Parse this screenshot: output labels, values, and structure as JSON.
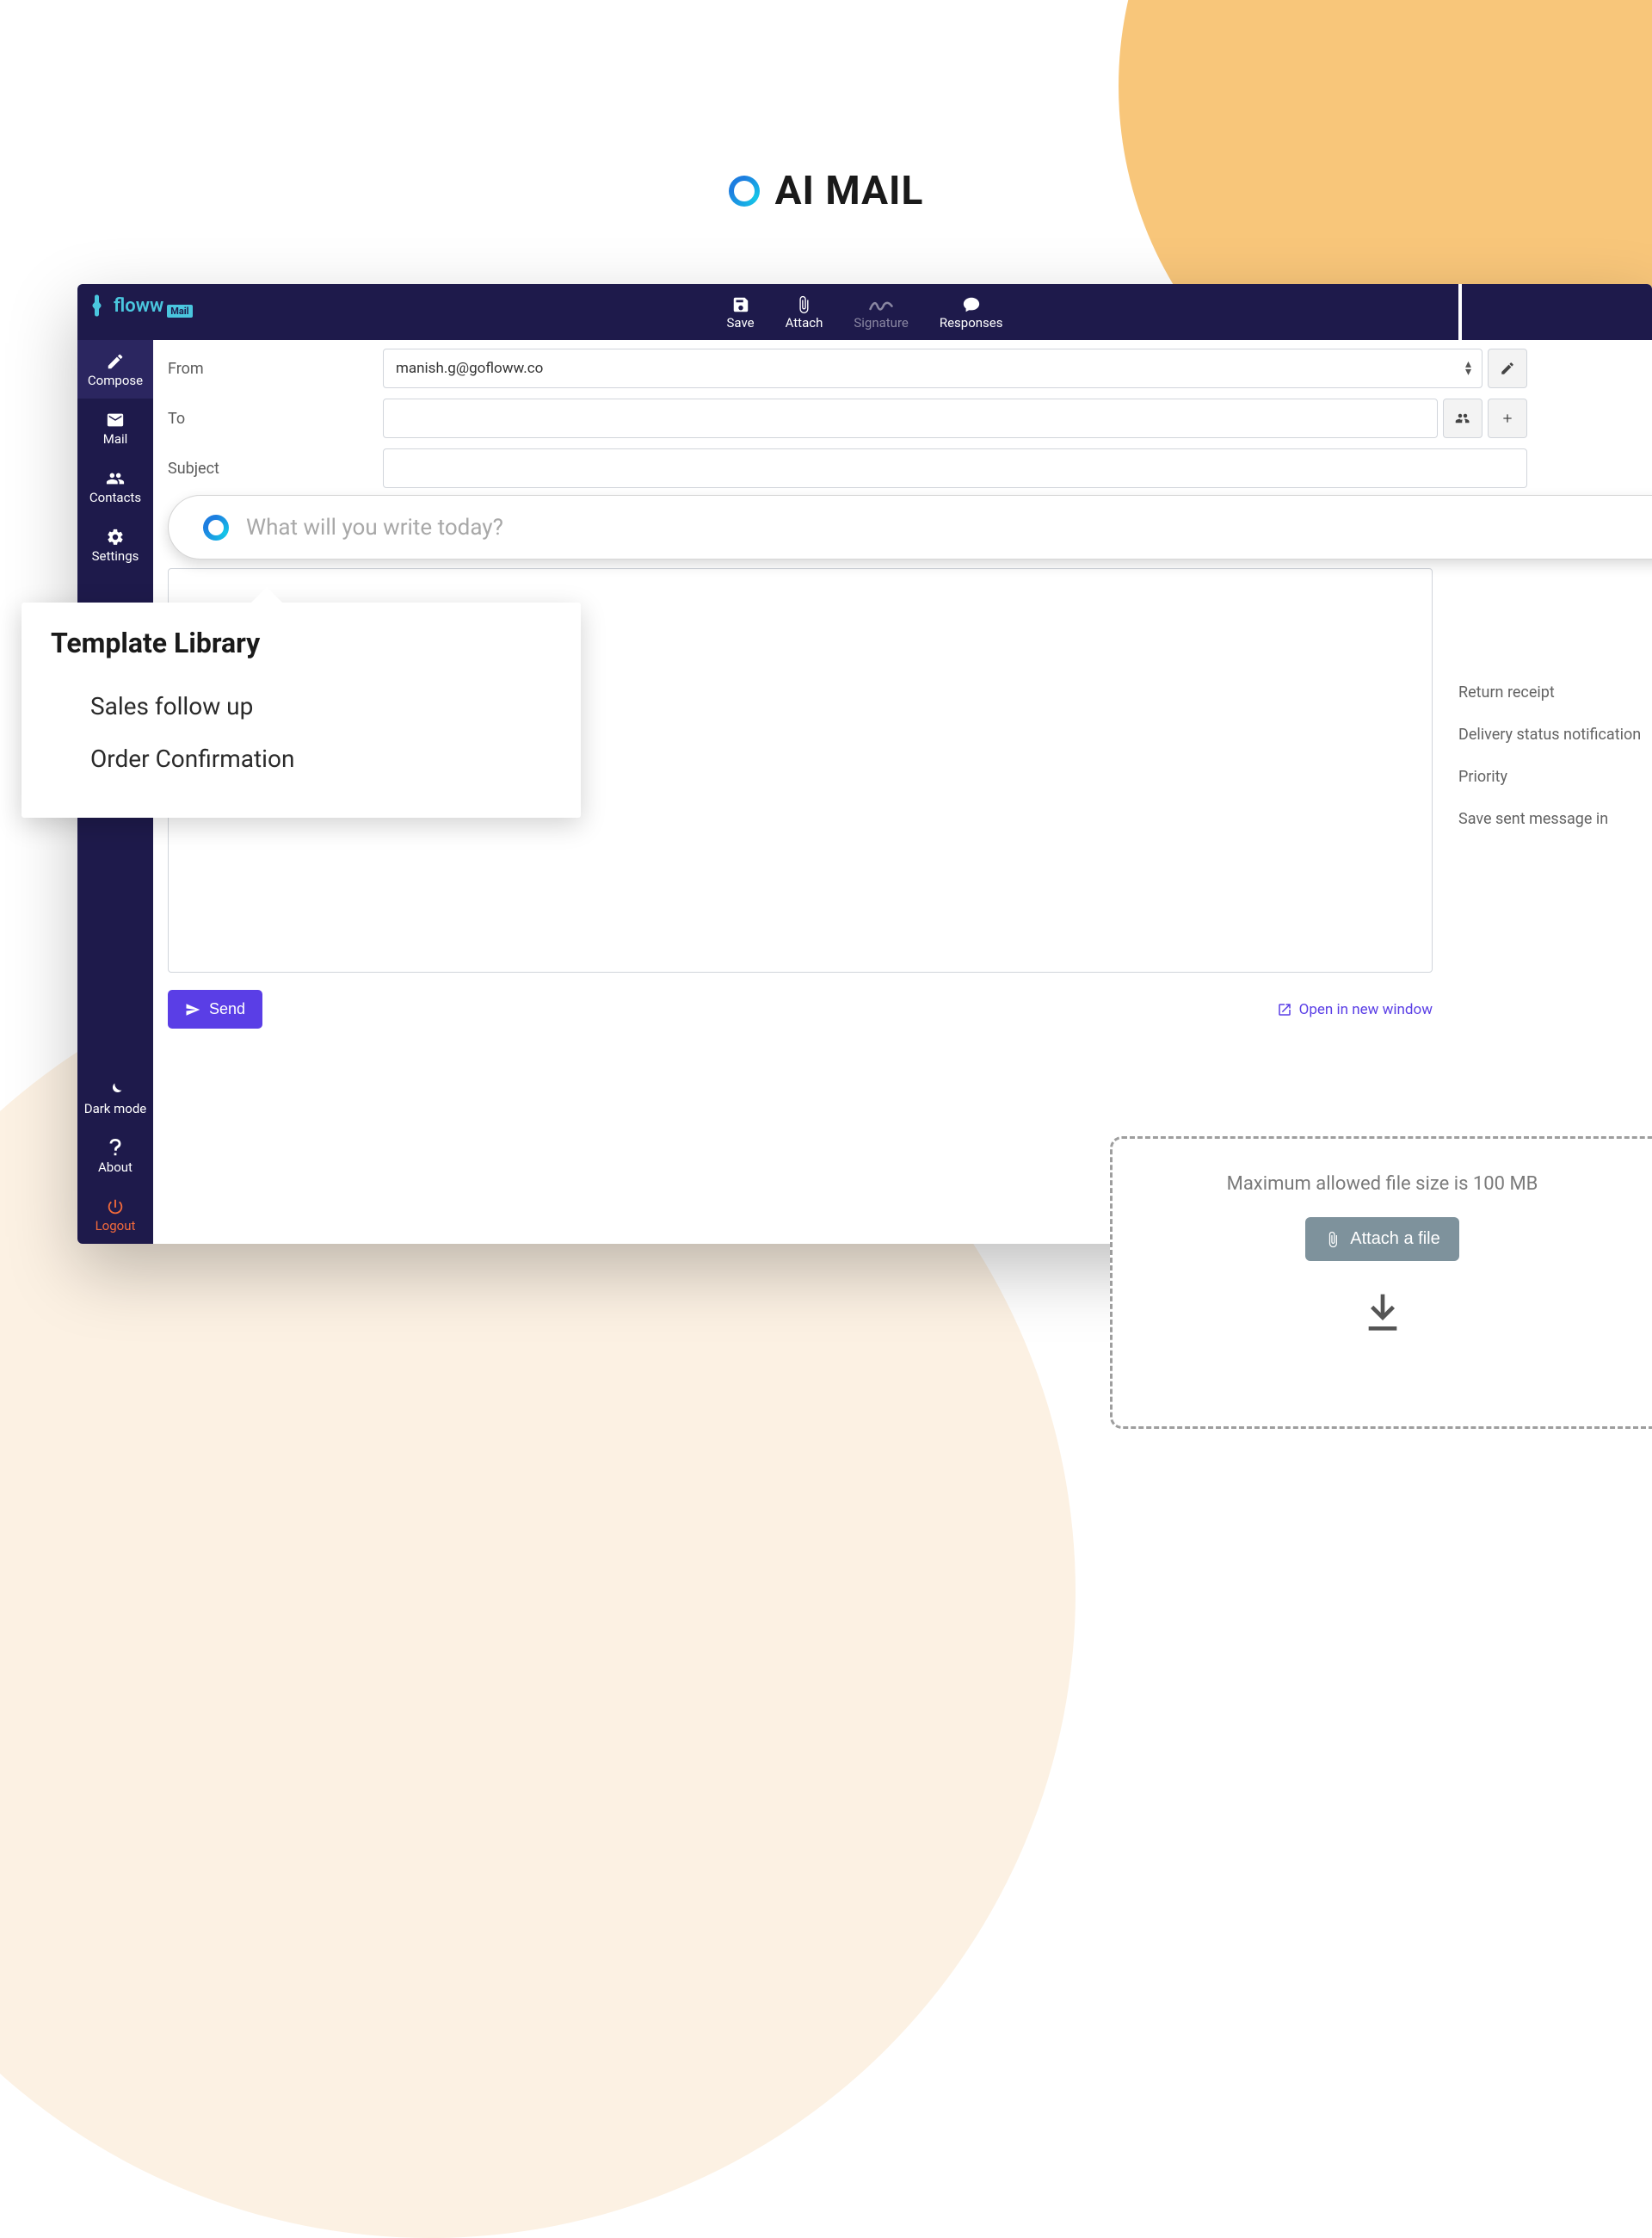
{
  "page": {
    "title_text": "AI MAIL"
  },
  "logo": {
    "text": "floww",
    "badge": "Mail"
  },
  "toolbar": {
    "save_label": "Save",
    "attach_label": "Attach",
    "signature_label": "Signature",
    "responses_label": "Responses"
  },
  "sidebar": {
    "compose_label": "Compose",
    "mail_label": "Mail",
    "contacts_label": "Contacts",
    "settings_label": "Settings",
    "darkmode_label": "Dark mode",
    "about_label": "About",
    "logout_label": "Logout"
  },
  "compose": {
    "from_label": "From",
    "from_value": "manish.g@gofloww.co",
    "to_label": "To",
    "to_value": "",
    "subject_label": "Subject",
    "subject_value": "",
    "ai_placeholder": "What will you write today?",
    "send_label": "Send",
    "open_new_window_label": "Open in new window"
  },
  "right_settings": {
    "items": [
      "Return receipt",
      "Delivery status notification",
      "Priority",
      "Save sent message in"
    ]
  },
  "template_popup": {
    "title": "Template Library",
    "items": [
      "Sales follow up",
      "Order Confirmation"
    ]
  },
  "attach_widget": {
    "info_text": "Maximum allowed  file size is 100 MB",
    "button_label": "Attach a file"
  }
}
